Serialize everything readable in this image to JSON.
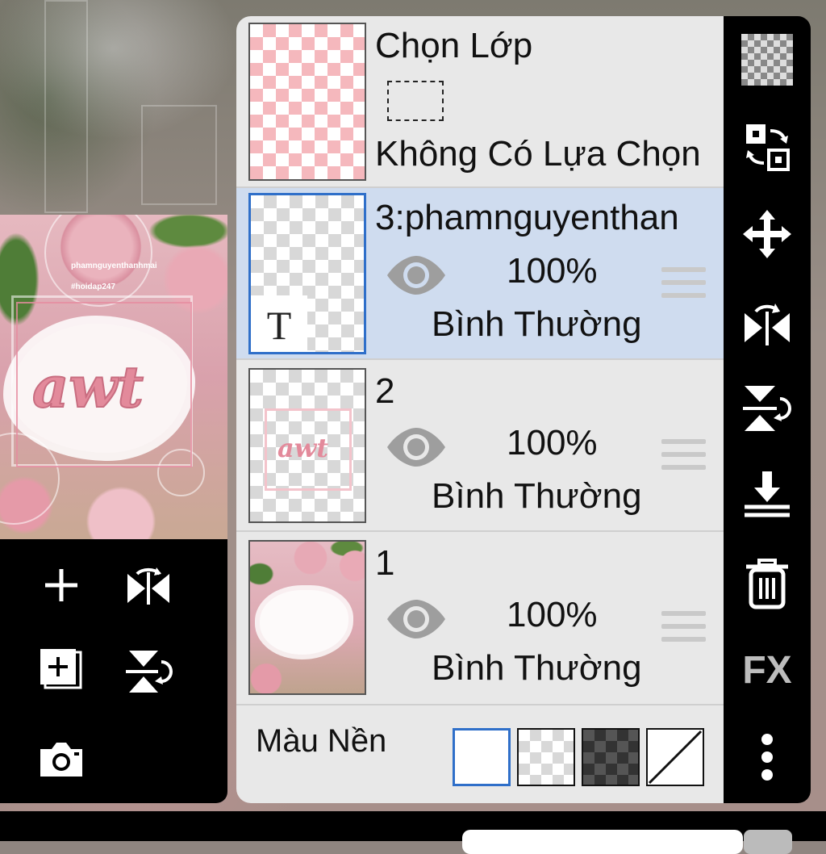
{
  "select_layer": {
    "title": "Chọn Lớp",
    "subtitle": "Không Có Lựa Chọn"
  },
  "layers": [
    {
      "name": "3:phamnguyenthan",
      "opacity": "100%",
      "blend": "Bình Thường",
      "type_icon": "T",
      "selected": true
    },
    {
      "name": "2",
      "opacity": "100%",
      "blend": "Bình Thường",
      "selected": false
    },
    {
      "name": "1",
      "opacity": "100%",
      "blend": "Bình Thường",
      "selected": false
    }
  ],
  "background": {
    "label": "Màu Nền",
    "options": [
      "white",
      "transparent-light",
      "transparent-dark",
      "none"
    ],
    "selected": "white"
  },
  "preview": {
    "watermark_1": "phamnguyenthanhmai",
    "watermark_2": "#hoidap247",
    "art_text": "awt"
  },
  "thumb_art_text": "awt",
  "right_tools": [
    "checkerboard-icon",
    "swap-layers-icon",
    "move-icon",
    "flip-horizontal-icon",
    "flip-vertical-icon",
    "merge-down-icon",
    "delete-icon",
    "fx-icon",
    "more-icon"
  ],
  "right_fx_label": "FX",
  "left_tools": [
    "add-layer-icon",
    "flip-horizontal-icon",
    "add-copy-layer-icon",
    "flip-vertical-icon",
    "camera-icon"
  ],
  "colors": {
    "selected_accent": "#2f6fc9",
    "selected_row_bg": "#cfdcef",
    "panel_bg": "#e8e8e8",
    "toolbar_bg": "#000000"
  }
}
